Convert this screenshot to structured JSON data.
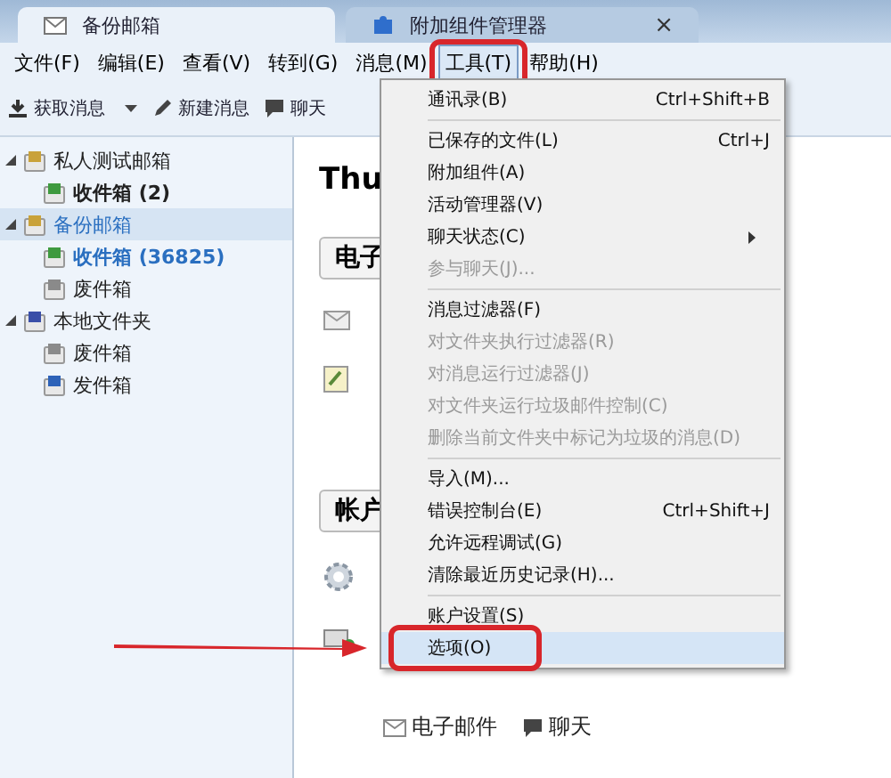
{
  "tabs": [
    {
      "label": "备份邮箱",
      "selected": true
    },
    {
      "label": "附加组件管理器",
      "selected": false,
      "close": "×"
    }
  ],
  "menu_bar": [
    {
      "label": "文件(F)",
      "selected": false,
      "annotated": false
    },
    {
      "label": "编辑(E)",
      "selected": false,
      "annotated": false
    },
    {
      "label": "查看(V)",
      "selected": false,
      "annotated": false
    },
    {
      "label": "转到(G)",
      "selected": false,
      "annotated": false
    },
    {
      "label": "消息(M)",
      "selected": false,
      "annotated": false
    },
    {
      "label": "工具(T)",
      "selected": true,
      "annotated": true
    },
    {
      "label": "帮助(H)",
      "selected": false,
      "annotated": false
    }
  ],
  "toolbar": [
    {
      "label": "获取消息",
      "kind": "download",
      "dropdown": true
    },
    {
      "label": "新建消息",
      "kind": "pencil",
      "dropdown": false
    },
    {
      "label": "聊天",
      "kind": "chat",
      "dropdown": false
    }
  ],
  "folders": [
    {
      "name": "私人测试邮箱",
      "kind": "account",
      "selected": false,
      "children": [
        {
          "name": "收件箱 (2)",
          "kind": "inbox",
          "unread": true
        }
      ]
    },
    {
      "name": "备份邮箱",
      "kind": "account",
      "selected": true,
      "children": [
        {
          "name": "收件箱 (36825)",
          "kind": "inbox",
          "unread": true
        },
        {
          "name": "废件箱",
          "kind": "trash",
          "unread": false
        }
      ]
    },
    {
      "name": "本地文件夹",
      "kind": "local",
      "selected": false,
      "children": [
        {
          "name": "废件箱",
          "kind": "trash",
          "unread": false
        },
        {
          "name": "发件箱",
          "kind": "outbox",
          "unread": false
        }
      ]
    }
  ],
  "main": {
    "heading": "Thu",
    "sections": [
      {
        "label": "电子"
      },
      {
        "label": "帐户"
      }
    ],
    "links": [
      {
        "label": "电子邮件",
        "kind": "mail"
      },
      {
        "label": "聊天",
        "kind": "chat"
      }
    ]
  },
  "tools_menu": [
    {
      "kind": "item",
      "label": "通讯录(B)",
      "shortcut": "Ctrl+Shift+B",
      "disabled": false,
      "selected": false,
      "submenu": false,
      "pointed": false
    },
    {
      "kind": "separator"
    },
    {
      "kind": "item",
      "label": "已保存的文件(L)",
      "shortcut": "Ctrl+J",
      "disabled": false,
      "selected": false,
      "submenu": false,
      "pointed": false
    },
    {
      "kind": "item",
      "label": "附加组件(A)",
      "disabled": false,
      "selected": false,
      "submenu": false,
      "pointed": false
    },
    {
      "kind": "item",
      "label": "活动管理器(V)",
      "disabled": false,
      "selected": false,
      "submenu": false,
      "pointed": false
    },
    {
      "kind": "item",
      "label": "聊天状态(C)",
      "disabled": false,
      "selected": false,
      "submenu": true,
      "pointed": false
    },
    {
      "kind": "item",
      "label": "参与聊天(J)...",
      "disabled": true,
      "selected": false,
      "submenu": false,
      "pointed": false
    },
    {
      "kind": "separator"
    },
    {
      "kind": "item",
      "label": "消息过滤器(F)",
      "disabled": false,
      "selected": false,
      "submenu": false,
      "pointed": false
    },
    {
      "kind": "item",
      "label": "对文件夹执行过滤器(R)",
      "disabled": true,
      "selected": false,
      "submenu": false,
      "pointed": false
    },
    {
      "kind": "item",
      "label": "对消息运行过滤器(J)",
      "disabled": true,
      "selected": false,
      "submenu": false,
      "pointed": false
    },
    {
      "kind": "item",
      "label": "对文件夹运行垃圾邮件控制(C)",
      "disabled": true,
      "selected": false,
      "submenu": false,
      "pointed": false
    },
    {
      "kind": "item",
      "label": "删除当前文件夹中标记为垃圾的消息(D)",
      "disabled": true,
      "selected": false,
      "submenu": false,
      "pointed": false
    },
    {
      "kind": "separator"
    },
    {
      "kind": "item",
      "label": "导入(M)...",
      "disabled": false,
      "selected": false,
      "submenu": false,
      "pointed": false
    },
    {
      "kind": "item",
      "label": "错误控制台(E)",
      "shortcut": "Ctrl+Shift+J",
      "disabled": false,
      "selected": false,
      "submenu": false,
      "pointed": false
    },
    {
      "kind": "item",
      "label": "允许远程调试(G)",
      "disabled": false,
      "selected": false,
      "submenu": false,
      "pointed": false
    },
    {
      "kind": "item",
      "label": "清除最近历史记录(H)...",
      "disabled": false,
      "selected": false,
      "submenu": false,
      "pointed": false
    },
    {
      "kind": "separator"
    },
    {
      "kind": "item",
      "label": "账户设置(S)",
      "disabled": false,
      "selected": false,
      "submenu": false,
      "pointed": false
    },
    {
      "kind": "item",
      "label": "选项(O)",
      "disabled": false,
      "selected": true,
      "submenu": false,
      "pointed": true
    }
  ]
}
